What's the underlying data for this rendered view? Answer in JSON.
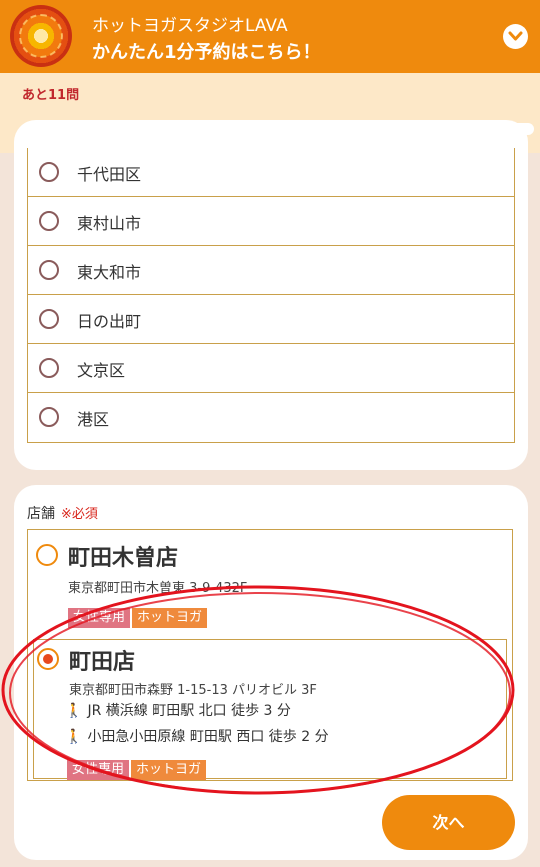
{
  "header": {
    "title": "ホットヨガスタジオLAVA",
    "subtitle": "かんたん1分予約はこちら！"
  },
  "progress": {
    "remaining_text": "あと11問",
    "fraction": 0.41
  },
  "areas": [
    {
      "label": "千代田区"
    },
    {
      "label": "東村山市"
    },
    {
      "label": "東大和市"
    },
    {
      "label": "日の出町"
    },
    {
      "label": "文京区"
    },
    {
      "label": "港区"
    }
  ],
  "store_section": {
    "label": "店舗",
    "required": "※必須"
  },
  "stores": [
    {
      "name": "町田木曽店",
      "address": "東京都町田市木曽東 3-9-432F",
      "selected": false,
      "tags": [
        "女性専用",
        "ホットヨガ"
      ]
    },
    {
      "name": "町田店",
      "address": "東京都町田市森野 1-15-13 パリオビル 3F",
      "selected": true,
      "access": [
        "JR 横浜線 町田駅 北口 徒歩 3 分",
        "小田急小田原線 町田駅 西口 徒歩 2 分"
      ],
      "tags": [
        "女性専用",
        "ホットヨガ"
      ]
    }
  ],
  "next_button": {
    "label": "次へ"
  },
  "colors": {
    "brand": "#ef8a0d",
    "progress": "#c1272d",
    "annotation": "#e3141e"
  }
}
